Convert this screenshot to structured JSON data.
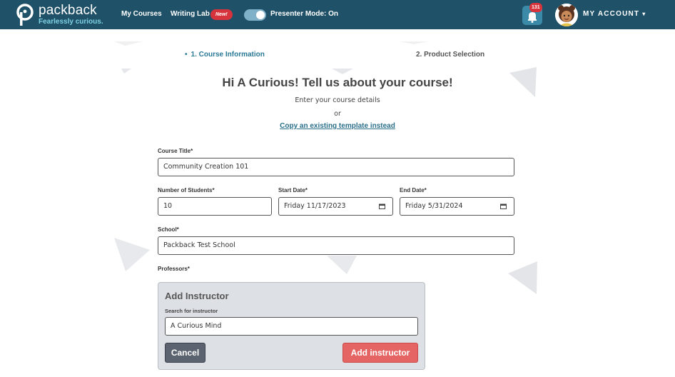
{
  "header": {
    "logo_text": "packback",
    "logo_tagline": "Fearlessly curious.",
    "nav": {
      "my_courses": "My Courses",
      "writing_lab": "Writing Lab",
      "new_badge": "New!",
      "presenter_mode": "Presenter Mode: On"
    },
    "presenter_mode_on": true,
    "notification_count": "131",
    "account_label": "MY ACCOUNT",
    "account_caret": "▾"
  },
  "steps": [
    "1. Course Information",
    "2. Product Selection"
  ],
  "step_bullet": "•",
  "intro": {
    "heading": "Hi A Curious! Tell us about your course!",
    "subtext": "Enter your course details",
    "or": "or",
    "copy_template": "Copy an existing template instead"
  },
  "form": {
    "course_title": {
      "label": "Course Title*",
      "value": "Community Creation 101"
    },
    "num_students": {
      "label": "Number of Students*",
      "value": "10"
    },
    "start_date": {
      "label": "Start Date*",
      "value": "Friday 11/17/2023"
    },
    "end_date": {
      "label": "End Date*",
      "value": "Friday 5/31/2024"
    },
    "school": {
      "label": "School*",
      "value": "Packback Test School"
    },
    "professors_label": "Professors*"
  },
  "add_instructor": {
    "title": "Add Instructor",
    "search_label": "Search for instructor",
    "search_value": "A Curious Mind",
    "cancel": "Cancel",
    "add": "Add instructor"
  },
  "colors": {
    "header_bg": "#1f5168",
    "accent": "#2a7a96",
    "badge": "#d6333c",
    "add_button": "#e46563",
    "cancel_button": "#5b6370"
  }
}
